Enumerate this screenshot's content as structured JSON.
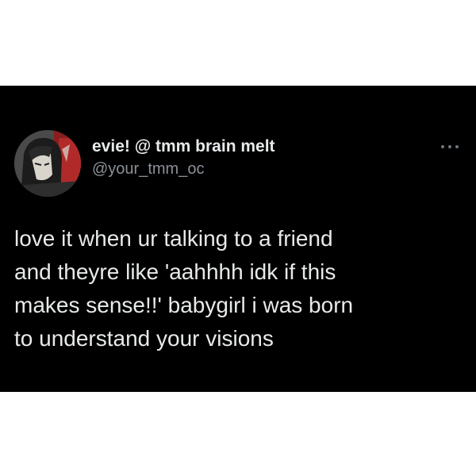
{
  "tweet": {
    "display_name": "evie! @ tmm brain melt",
    "handle": "@your_tmm_oc",
    "text": "love it when ur talking to a friend\nand theyre like 'aahhhh idk if this\nmakes sense!!'  babygirl i was born\nto understand your visions",
    "avatar_icon": "anime-character-avatar-icon",
    "more_icon": "more-options-icon"
  },
  "colors": {
    "card_background": "#000000",
    "page_background": "#ffffff",
    "primary_text": "#e7e9ea",
    "secondary_text": "#8b9097"
  }
}
